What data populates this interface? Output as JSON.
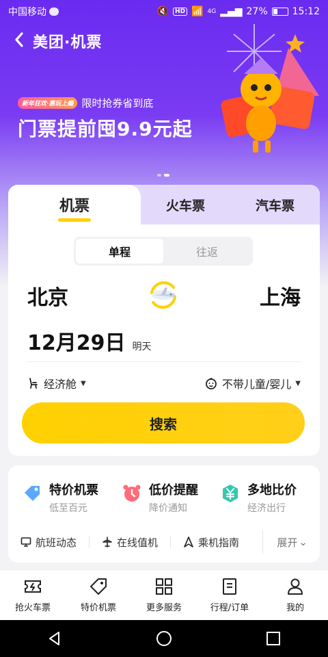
{
  "status_bar": {
    "carrier": "中国移动",
    "battery": "27%",
    "time": "15:12",
    "network": "4G",
    "hd": "HD"
  },
  "header": {
    "title": "美团·机票",
    "back_icon": "chevron-left-icon"
  },
  "promo": {
    "tag": "新年狂欢·惠玩上瘾",
    "subtitle": "限时抢券省到底",
    "headline": "门票提前囤9.9元起"
  },
  "tabs": [
    {
      "label": "机票",
      "active": true
    },
    {
      "label": "火车票",
      "active": false
    },
    {
      "label": "汽车票",
      "active": false
    }
  ],
  "trip_type": {
    "options": [
      "单程",
      "往返"
    ],
    "selected": "单程"
  },
  "route": {
    "from": "北京",
    "to": "上海"
  },
  "date": {
    "value": "12月29日",
    "relative": "明天"
  },
  "options": {
    "cabin": "经济舱",
    "passengers": "不带儿童/婴儿"
  },
  "search_button": "搜索",
  "services": [
    {
      "title": "特价机票",
      "subtitle": "低至百元",
      "icon": "price-tag-icon"
    },
    {
      "title": "低价提醒",
      "subtitle": "降价通知",
      "icon": "alarm-clock-icon"
    },
    {
      "title": "多地比价",
      "subtitle": "经济出行",
      "icon": "yuan-icon"
    }
  ],
  "quick_links": [
    {
      "label": "航班动态",
      "icon": "monitor-icon"
    },
    {
      "label": "在线值机",
      "icon": "plane-icon"
    },
    {
      "label": "乘机指南",
      "icon": "navigate-icon"
    }
  ],
  "expand_label": "展开",
  "bottom_nav": [
    {
      "label": "抢火车票",
      "icon": "ticket-icon"
    },
    {
      "label": "特价机票",
      "icon": "price-tag-icon"
    },
    {
      "label": "更多服务",
      "icon": "grid-icon"
    },
    {
      "label": "行程/订单",
      "icon": "document-icon"
    },
    {
      "label": "我的",
      "icon": "user-icon"
    }
  ],
  "colors": {
    "brand_purple": "#6a2bf0",
    "accent_yellow": "#ffd100"
  }
}
